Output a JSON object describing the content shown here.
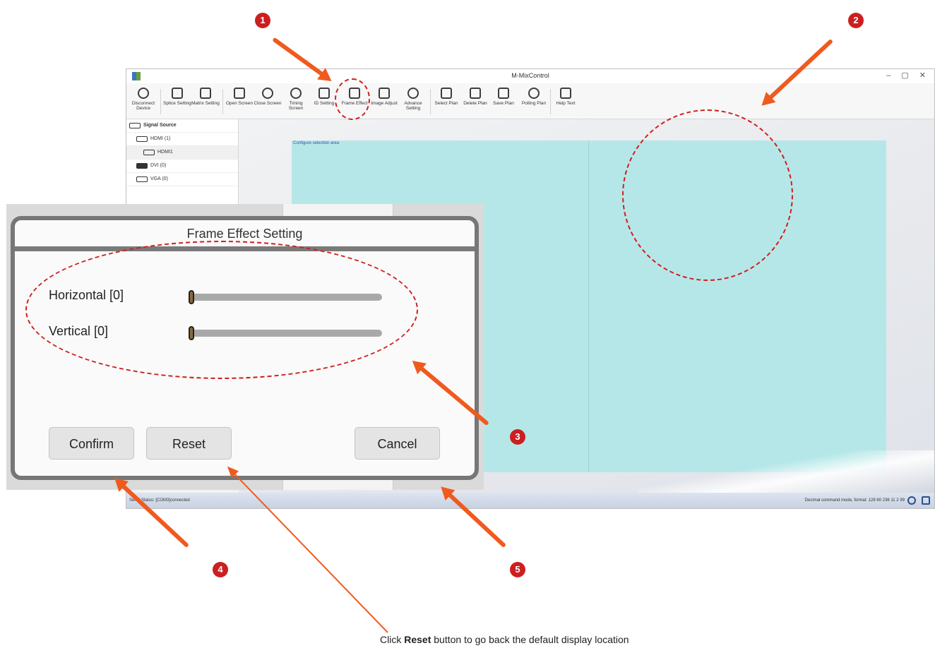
{
  "app": {
    "title": "M-MixControl",
    "window_controls": "– ▢ ✕"
  },
  "toolbar": [
    {
      "label": "Disconnect Device",
      "icon": "disconnect-icon"
    },
    {
      "label": "Splice Setting",
      "icon": "splice-icon"
    },
    {
      "label": "Matrix Setting",
      "icon": "matrix-icon"
    },
    {
      "label": "Open Screen",
      "icon": "open-screen-icon"
    },
    {
      "label": "Close Screen",
      "icon": "power-icon"
    },
    {
      "label": "Timing Screen",
      "icon": "clock-icon"
    },
    {
      "label": "ID Setting",
      "icon": "id-icon"
    },
    {
      "label": "Frame Effect",
      "icon": "frame-icon"
    },
    {
      "label": "Image Adjust",
      "icon": "image-icon"
    },
    {
      "label": "Advance Setting",
      "icon": "gear-icon"
    },
    {
      "label": "Select Plan",
      "icon": "select-plan-icon"
    },
    {
      "label": "Delete Plan",
      "icon": "delete-plan-icon"
    },
    {
      "label": "Save Plan",
      "icon": "save-icon"
    },
    {
      "label": "Polling Plan",
      "icon": "polling-icon"
    },
    {
      "label": "Help Text",
      "icon": "help-icon"
    }
  ],
  "sidebar": {
    "header": "Signal Source",
    "items": [
      {
        "label": "HDMI (1)"
      },
      {
        "label": "HDMI1"
      },
      {
        "label": "DVI (0)"
      },
      {
        "label": "VGA (0)"
      }
    ]
  },
  "canvas": {
    "area_label": "Configure selection area"
  },
  "statusbar": {
    "left": "Serial Status: [COM3]connected",
    "right": "Decimal command mode, format: 128 80 236 11 2 99"
  },
  "dialog": {
    "title": "Frame Effect Setting",
    "horizontal_label": "Horizontal [0]",
    "vertical_label": "Vertical [0]",
    "horizontal_value": 0,
    "vertical_value": 0,
    "confirm": "Confirm",
    "reset": "Reset",
    "cancel": "Cancel"
  },
  "callouts": {
    "badges": [
      "1",
      "2",
      "3",
      "4",
      "5"
    ],
    "caption_prefix": "Click ",
    "caption_bold": "Reset",
    "caption_suffix": " button to go back the default display location"
  },
  "colors": {
    "accent_red": "#cc1f1f",
    "arrow_orange": "#f05a1e",
    "config_area": "#b6e7e8"
  }
}
